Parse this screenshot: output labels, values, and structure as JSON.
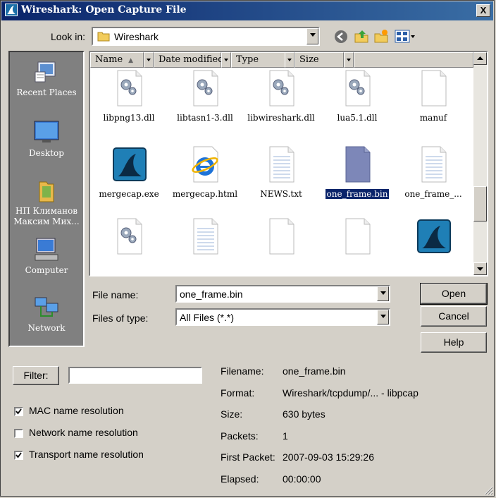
{
  "window": {
    "title": "Wireshark: Open Capture File",
    "close_label": "X"
  },
  "toolbar": {
    "look_in_label": "Look in:",
    "look_in_value": "Wireshark"
  },
  "places": [
    {
      "label": "Recent Places",
      "icon": "recent-places-icon"
    },
    {
      "label": "Desktop",
      "icon": "desktop-icon"
    },
    {
      "label": "НП Климанов Максим Мих...",
      "icon": "user-folder-icon"
    },
    {
      "label": "Computer",
      "icon": "computer-icon"
    },
    {
      "label": "Network",
      "icon": "network-icon"
    }
  ],
  "columns": [
    "Name",
    "Date modified",
    "Type",
    "Size"
  ],
  "files": [
    {
      "name": "libpng13.dll",
      "icon": "dll-icon"
    },
    {
      "name": "libtasn1-3.dll",
      "icon": "dll-icon"
    },
    {
      "name": "libwireshark.dll",
      "icon": "dll-icon"
    },
    {
      "name": "lua5.1.dll",
      "icon": "dll-icon"
    },
    {
      "name": "manuf",
      "icon": "blank-file-icon"
    },
    {
      "name": "mergecap.exe",
      "icon": "wireshark-app-icon"
    },
    {
      "name": "mergecap.html",
      "icon": "ie-html-icon"
    },
    {
      "name": "NEWS.txt",
      "icon": "text-file-icon"
    },
    {
      "name": "one_frame.bin",
      "icon": "capture-file-icon",
      "selected": true
    },
    {
      "name": "one_frame_...",
      "icon": "text-file-icon"
    },
    {
      "name": "",
      "icon": "dll-icon"
    },
    {
      "name": "",
      "icon": "text-file-icon"
    },
    {
      "name": "",
      "icon": "blank-file-icon"
    },
    {
      "name": "",
      "icon": "blank-file-icon"
    },
    {
      "name": "",
      "icon": "wireshark-app-icon"
    }
  ],
  "form": {
    "file_name_label": "File name:",
    "file_name_value": "one_frame.bin",
    "files_of_type_label": "Files of type:",
    "files_of_type_value": "All Files (*.*)"
  },
  "buttons": {
    "open": "Open",
    "cancel": "Cancel",
    "help": "Help",
    "filter": "Filter:"
  },
  "options": [
    {
      "label": "MAC name resolution",
      "checked": true
    },
    {
      "label": "Network name resolution",
      "checked": false
    },
    {
      "label": "Transport name resolution",
      "checked": true
    }
  ],
  "info": [
    {
      "label": "Filename:",
      "value": "one_frame.bin"
    },
    {
      "label": "Format:",
      "value": "Wireshark/tcpdump/... - libpcap"
    },
    {
      "label": "Size:",
      "value": "630 bytes"
    },
    {
      "label": "Packets:",
      "value": "1"
    },
    {
      "label": "First Packet:",
      "value": "2007-09-03 15:29:26"
    },
    {
      "label": "Elapsed:",
      "value": "00:00:00"
    }
  ],
  "colors": {
    "title_bar": "#0a246a",
    "selection": "#0a246a",
    "face": "#d4d0c8"
  }
}
